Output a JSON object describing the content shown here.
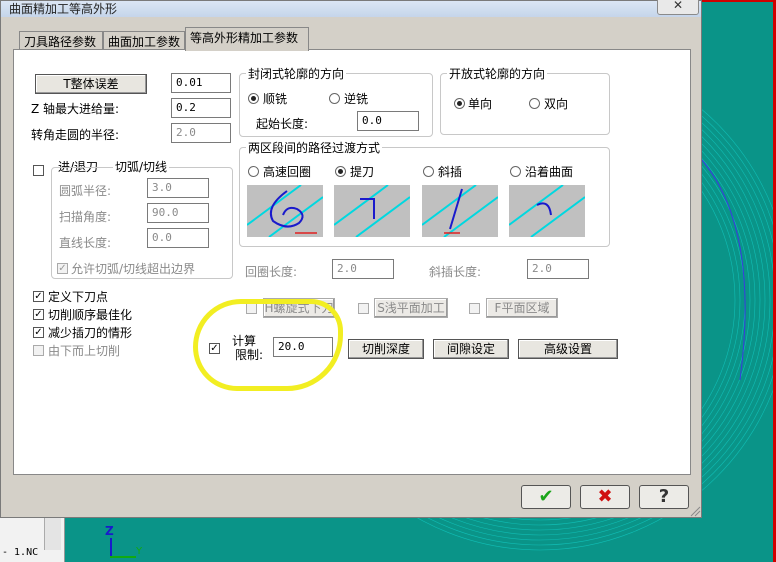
{
  "window": {
    "title": "曲面精加工等高外形",
    "close": "✕"
  },
  "tabs": [
    {
      "label": "刀具路径参数"
    },
    {
      "label": "曲面加工参数"
    },
    {
      "label": "等高外形精加工参数"
    }
  ],
  "params": {
    "total_tolerance_button": "T整体误差",
    "total_tolerance_value": "0.01",
    "z_step_label": "Z 轴最大进给量:",
    "z_step_value": "0.2",
    "corner_radius_label": "转角走圆的半径:",
    "corner_radius_value": "2.0"
  },
  "entry_exit": {
    "checkbox_label": "进/退刀",
    "group_title": "切弧/切线",
    "arc_radius_label": "圆弧半径:",
    "arc_radius_value": "3.0",
    "sweep_angle_label": "扫描角度:",
    "sweep_angle_value": "90.0",
    "line_length_label": "直线长度:",
    "line_length_value": "0.0",
    "allow_overrun_label": "允许切弧/切线超出边界",
    "allow_overrun_checked": "✓"
  },
  "closed_contour": {
    "title": "封闭式轮廓的方向",
    "option_climb": "顺铣",
    "option_conventional": "逆铣",
    "start_length_label": "起始长度:",
    "start_length_value": "0.0"
  },
  "open_contour": {
    "title": "开放式轮廓的方向",
    "option_one_way": "单向",
    "option_two_way": "双向"
  },
  "transition": {
    "title": "两区段间的路径过渡方式",
    "options": [
      {
        "label": "高速回圈",
        "selected": false
      },
      {
        "label": "提刀",
        "selected": true
      },
      {
        "label": "斜插",
        "selected": false
      },
      {
        "label": "沿着曲面",
        "selected": false
      }
    ],
    "loop_length_label": "回圈长度:",
    "loop_length_value": "2.0",
    "ramp_length_label": "斜插长度:",
    "ramp_length_value": "2.0"
  },
  "options": {
    "define_entry_point": "定义下刀点",
    "optimize_order": "切削顺序最佳化",
    "reduce_plunge": "减少插刀的情形",
    "bottom_up": "由下而上切削",
    "check": "✓"
  },
  "extra": {
    "helix_button": "H螺旋式下刀",
    "shallow_button": "S浅平面加工",
    "flat_button": "F平面区域",
    "calc_label_1": "计算",
    "calc_label_2": "限制:",
    "calc_value": "20.0",
    "cut_depth_button": "切削深度",
    "gap_button": "间隙设定",
    "advanced_button": "高级设置"
  },
  "footer": {
    "ok": "✔",
    "cancel": "✖",
    "help": "?"
  },
  "viewport": {
    "status_text": "- 1.NC",
    "axis_z": "Z",
    "axis_y": "Y"
  },
  "colors": {
    "accent_cyan": "#00d8e0",
    "ok_green": "#1aa51a",
    "cancel_red": "#d01010",
    "highlight_yellow": "#f2ee22"
  }
}
